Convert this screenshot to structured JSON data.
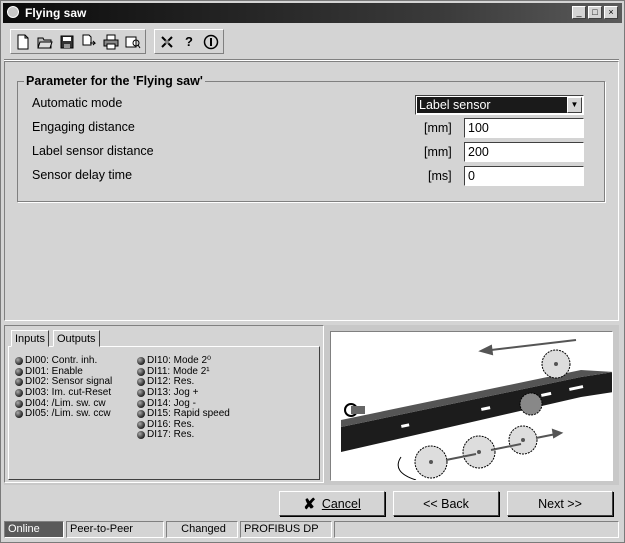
{
  "window": {
    "title": "Flying saw"
  },
  "toolbar": {
    "icons": [
      "new-file",
      "open-folder",
      "save",
      "export-file",
      "print",
      "print-preview",
      "tools",
      "help",
      "info"
    ]
  },
  "parameters": {
    "group_title": "Parameter for the 'Flying saw'",
    "rows": [
      {
        "label": "Automatic mode",
        "unit": "",
        "value": "Label sensor",
        "type": "select"
      },
      {
        "label": "Engaging distance",
        "unit": "[mm]",
        "value": "100",
        "type": "input"
      },
      {
        "label": "Label sensor distance",
        "unit": "[mm]",
        "value": "200",
        "type": "input"
      },
      {
        "label": "Sensor delay time",
        "unit": "[ms]",
        "value": "0",
        "type": "input"
      }
    ]
  },
  "io": {
    "tabs": [
      "Inputs",
      "Outputs"
    ],
    "inputs_left": [
      "DI00: Contr. inh.",
      "DI01: Enable",
      "DI02: Sensor signal",
      "DI03: Im. cut-Reset",
      "DI04: /Lim. sw. cw",
      "DI05: /Lim. sw. ccw"
    ],
    "inputs_right": [
      "DI10: Mode 2⁰",
      "DI11: Mode 2¹",
      "DI12: Res.",
      "DI13: Jog +",
      "DI14: Jog -",
      "DI15: Rapid speed",
      "DI16: Res.",
      "DI17: Res."
    ]
  },
  "buttons": {
    "cancel": "Cancel",
    "back": "<< Back",
    "next": "Next >>"
  },
  "status": [
    "Online",
    "Peer-to-Peer",
    "Changed",
    "PROFIBUS DP"
  ]
}
